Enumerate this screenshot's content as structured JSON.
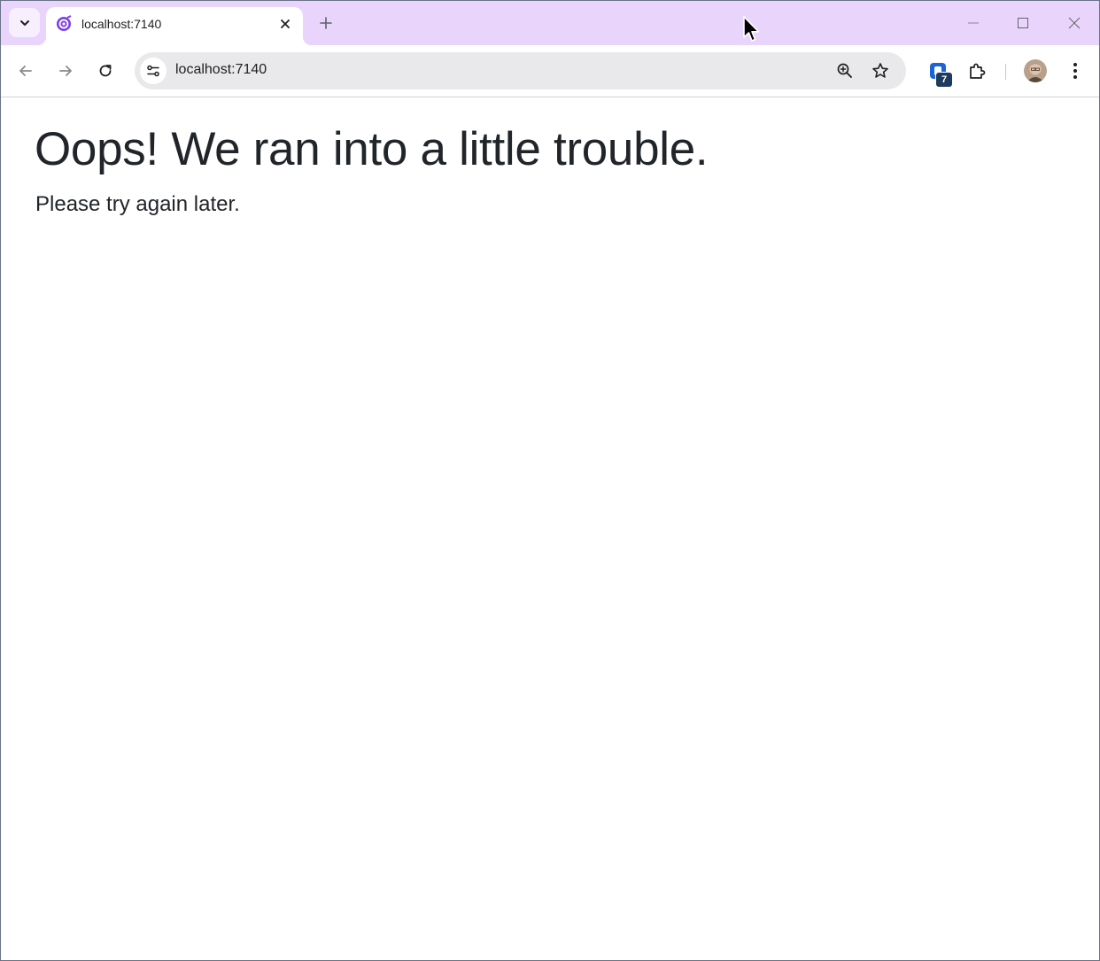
{
  "browser": {
    "tab": {
      "title": "localhost:7140"
    },
    "address_bar": {
      "url": "localhost:7140"
    },
    "extensions_badge": "7"
  },
  "page": {
    "heading": "Oops! We ran into a little trouble.",
    "message": "Please try again later."
  },
  "icons": {
    "tab_search": "chevron-down-icon",
    "favicon": "blazor-icon",
    "tab_close": "close-icon",
    "new_tab": "plus-icon",
    "minimize": "minimize-icon",
    "maximize": "maximize-icon",
    "window_close": "close-icon",
    "back": "arrow-left-icon",
    "forward": "arrow-right-icon",
    "reload": "reload-icon",
    "site_info": "tune-icon",
    "zoom": "zoom-in-icon",
    "bookmark": "star-icon",
    "extension_app": "app-extension-icon",
    "extensions": "puzzle-icon",
    "profile": "avatar",
    "menu": "kebab-menu-icon"
  },
  "colors": {
    "tabstrip_bg": "#e9d5fb",
    "text": "#212529",
    "omnibox_bg": "#e9e9ec"
  }
}
